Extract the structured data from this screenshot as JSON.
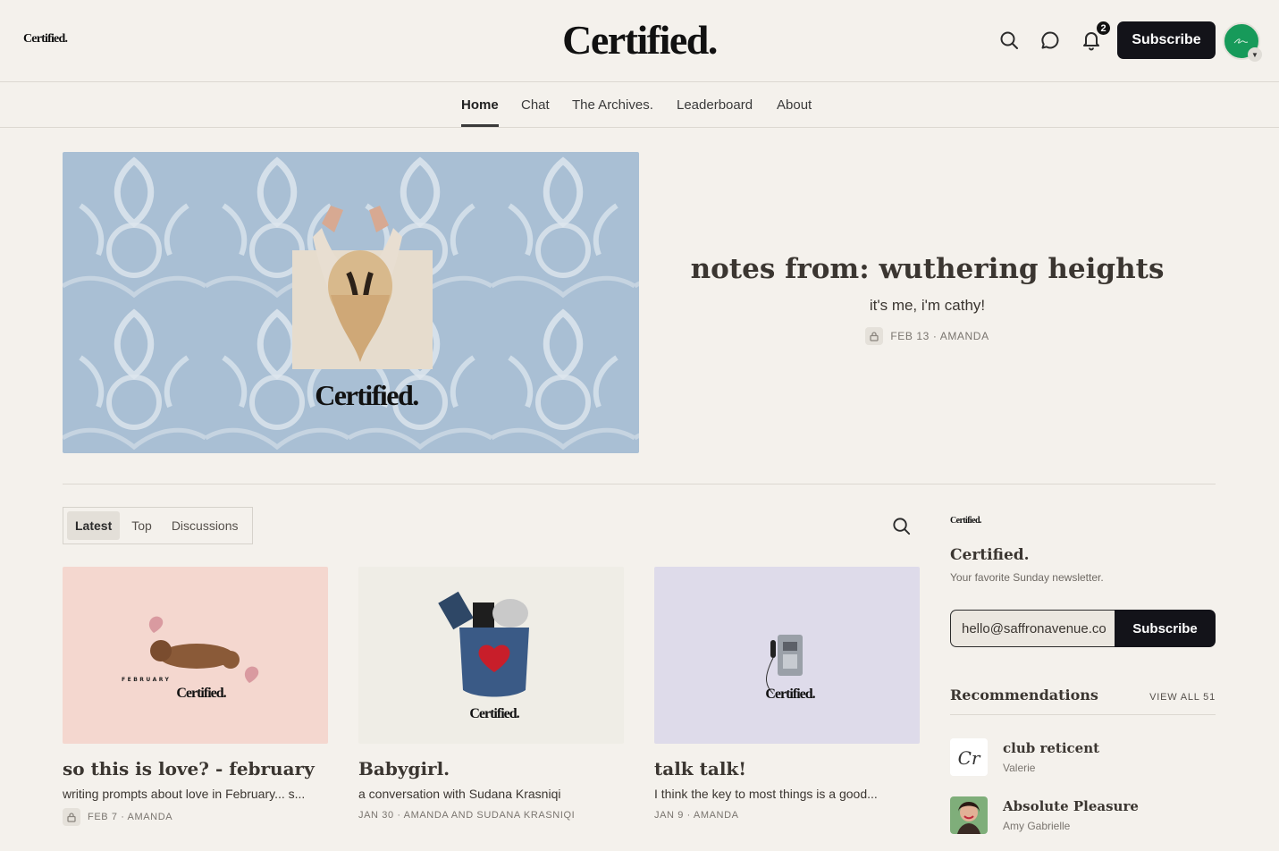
{
  "header": {
    "small_logo": "Certified.",
    "logo": "Certified.",
    "notification_count": "2",
    "subscribe_label": "Subscribe",
    "icons": [
      "search-icon",
      "chat-bubble-icon",
      "bell-icon"
    ]
  },
  "nav": {
    "items": [
      {
        "label": "Home",
        "active": true
      },
      {
        "label": "Chat"
      },
      {
        "label": "The Archives."
      },
      {
        "label": "Leaderboard"
      },
      {
        "label": "About"
      }
    ]
  },
  "hero": {
    "image_caption": "Certified.",
    "title": "notes from: wuthering heights",
    "subtitle": "it's me, i'm cathy!",
    "meta": "FEB 13 · AMANDA"
  },
  "feed": {
    "tabs": [
      "Latest",
      "Top",
      "Discussions"
    ],
    "active_tab": "Latest",
    "posts": [
      {
        "title": "so this is love? - february",
        "subtitle": "writing prompts about love in February... s...",
        "meta": "FEB 7 · AMANDA",
        "locked": true,
        "image_caption": "Certified.",
        "image_label": "FEBRUARY",
        "image_bg": "#f4d7cf"
      },
      {
        "title": "Babygirl.",
        "subtitle": "a conversation with Sudana Krasniqi",
        "meta": "JAN 30 · AMANDA AND SUDANA KRASNIQI",
        "locked": false,
        "image_caption": "Certified.",
        "image_bg": "#efede6"
      },
      {
        "title": "talk talk!",
        "subtitle": "I think the key to most things is a good...",
        "meta": "JAN 9 · AMANDA",
        "locked": false,
        "image_caption": "Certified.",
        "image_bg": "#dedbea"
      }
    ]
  },
  "sidebar": {
    "logo": "Certified.",
    "name": "Certified.",
    "description": "Your favorite Sunday newsletter.",
    "email_value": "hello@saffronavenue.com",
    "subscribe_label": "Subscribe",
    "recommendations_title": "Recommendations",
    "view_all": "VIEW ALL 51",
    "recommendations": [
      {
        "name": "club reticent",
        "author": "Valerie",
        "thumb_text": "Cr"
      },
      {
        "name": "Absolute Pleasure",
        "author": "Amy Gabrielle"
      }
    ]
  },
  "colors": {
    "background": "#f4f1ec",
    "button": "#131319",
    "avatar": "#179a5a",
    "hero_pattern": "#a9bfd4"
  }
}
